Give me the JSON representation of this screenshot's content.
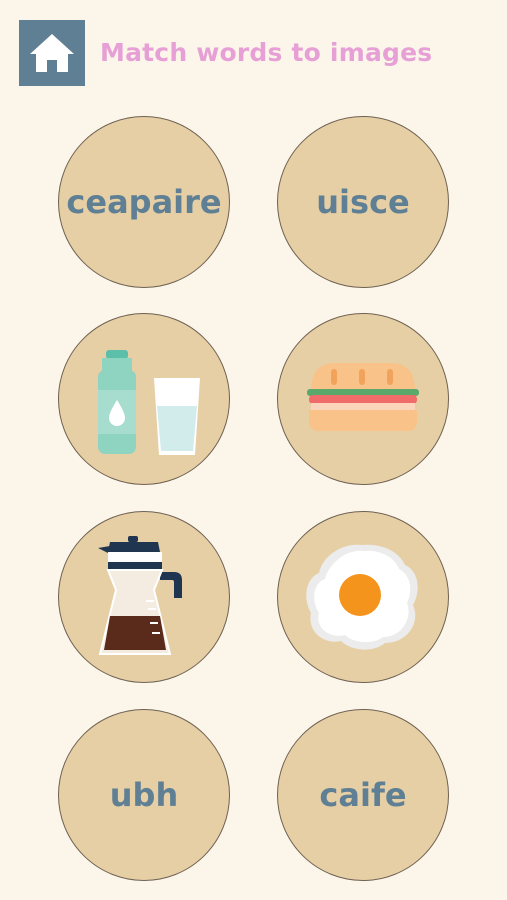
{
  "header": {
    "home_icon": "home-icon",
    "title": "Match words to images"
  },
  "colors": {
    "background": "#fcf5ea",
    "card": "#e6cfa5",
    "card_border": "#6e6151",
    "word_text": "#5f7f94",
    "title_text": "#e7a0d6",
    "home_button": "#5f7f94"
  },
  "cards": [
    {
      "type": "word",
      "text": "ceapaire"
    },
    {
      "type": "word",
      "text": "uisce"
    },
    {
      "type": "image",
      "icon": "water-bottle-and-glass-icon"
    },
    {
      "type": "image",
      "icon": "sandwich-icon"
    },
    {
      "type": "image",
      "icon": "coffee-pot-icon"
    },
    {
      "type": "image",
      "icon": "fried-egg-icon"
    },
    {
      "type": "word",
      "text": "ubh"
    },
    {
      "type": "word",
      "text": "caife"
    }
  ]
}
